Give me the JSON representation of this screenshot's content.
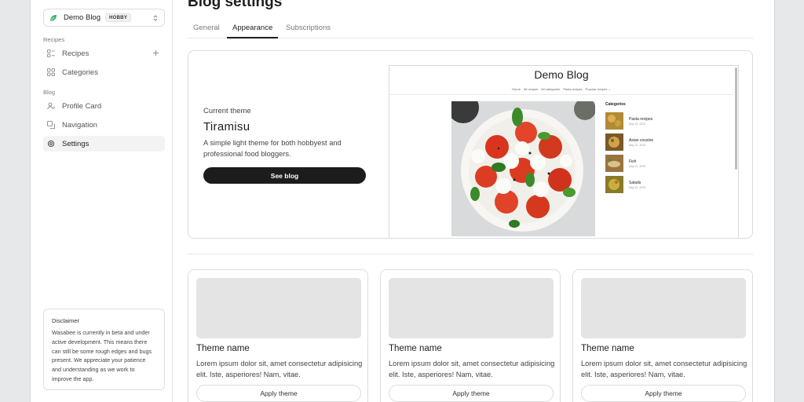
{
  "sidebar": {
    "blog_name": "Demo Blog",
    "plan_badge": "HOBBY",
    "sections": [
      {
        "label": "Recipes",
        "items": [
          {
            "label": "Recipes",
            "icon": "recipes-icon"
          },
          {
            "label": "Categories",
            "icon": "grid-icon"
          }
        ]
      },
      {
        "label": "Blog",
        "items": [
          {
            "label": "Profile Card",
            "icon": "user-icon"
          },
          {
            "label": "Navigation",
            "icon": "layers-icon"
          },
          {
            "label": "Settings",
            "icon": "gear-icon",
            "active": true
          }
        ]
      }
    ],
    "disclaimer": {
      "title": "Disclaimer",
      "body": "Wasabee is currently in beta and under active development. This means there can still be some rough edges and bugs present. We appreciate your patience and understanding as we work to improve the app."
    }
  },
  "header": {
    "title": "Blog settings",
    "tabs": [
      {
        "label": "General"
      },
      {
        "label": "Appearance",
        "active": true
      },
      {
        "label": "Subscriptions"
      }
    ]
  },
  "current_theme": {
    "label": "Current theme",
    "name": "Tiramisu",
    "description": "A simple light theme for both hobbyest and professional food bloggers.",
    "button": "See blog",
    "preview": {
      "title": "Demo Blog",
      "nav": [
        "Home",
        "All recipes",
        "All categories",
        "Pasta recipes",
        "Popular recipes ⌄"
      ],
      "categories_heading": "Categories",
      "categories": [
        {
          "name": "Pasta recipes",
          "date": "May 21, 2023"
        },
        {
          "name": "Asian cousine",
          "date": "May 21, 2023"
        },
        {
          "name": "Fish",
          "date": "May 21, 2023"
        },
        {
          "name": "Salads",
          "date": "May 21, 2023"
        }
      ]
    }
  },
  "themes": [
    {
      "name": "Theme name",
      "description": "Lorem ipsum dolor sit, amet consectetur adipisicing elit. Iste, asperiores! Nam, vitae.",
      "button": "Apply theme"
    },
    {
      "name": "Theme name",
      "description": "Lorem ipsum dolor sit, amet consectetur adipisicing elit. Iste, asperiores! Nam, vitae.",
      "button": "Apply theme"
    },
    {
      "name": "Theme name",
      "description": "Lorem ipsum dolor sit, amet consectetur adipisicing elit. Iste, asperiores! Nam, vitae.",
      "button": "Apply theme"
    }
  ],
  "colors": {
    "accent": "#1c1c1c",
    "leaf": "#3fae6a",
    "placeholder": "#e4e4e4"
  }
}
